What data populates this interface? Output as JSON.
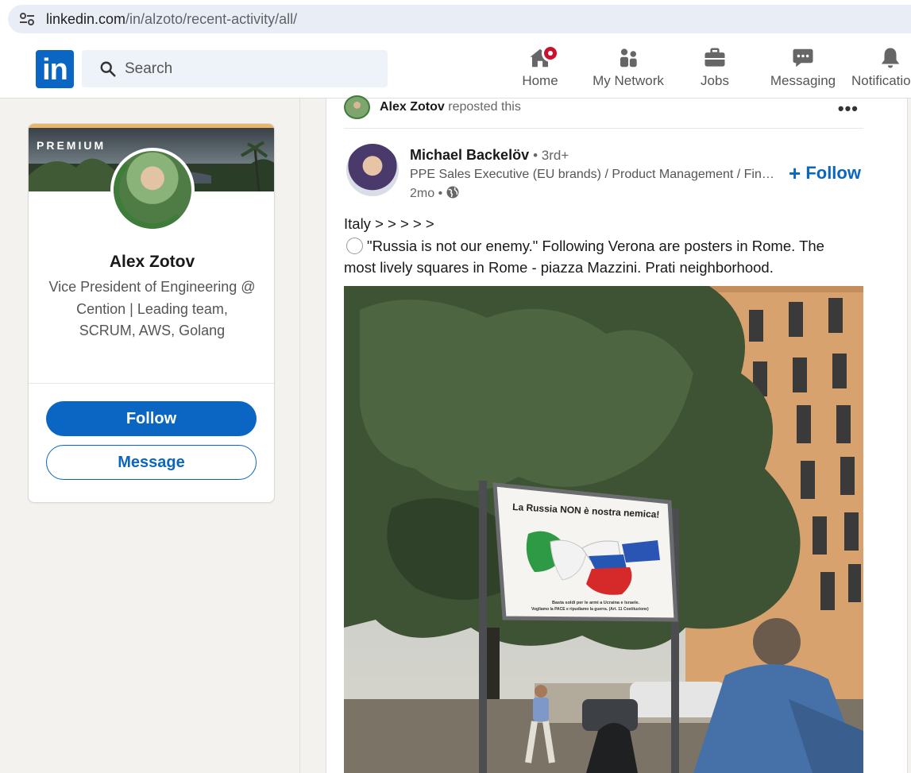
{
  "browser": {
    "url_domain": "linkedin.com",
    "url_path": "/in/alzoto/recent-activity/all/"
  },
  "header": {
    "logo_text": "in",
    "search_placeholder": "Search",
    "nav": {
      "home": "Home",
      "network": "My Network",
      "jobs": "Jobs",
      "messaging": "Messaging",
      "notifications": "Notifications"
    }
  },
  "profile": {
    "banner_label": "PREMIUM",
    "name": "Alex Zotov",
    "headline": "Vice President of Engineering @ Cention | Leading team, SCRUM, AWS, Golang",
    "follow_label": "Follow",
    "message_label": "Message"
  },
  "repost": {
    "name": "Alex Zotov",
    "action": "reposted this",
    "more": "•••"
  },
  "post": {
    "author": "Michael Backelöv",
    "degree": "• 3rd+",
    "description": "PPE Sales Executive (EU brands) / Product Management / Finance & Business Development",
    "time": "2mo •",
    "follow_label": "Follow",
    "text_line1": "Italy > > > > >",
    "text_line2": "\"Russia is not our enemy.\" Following Verona are posters in Rome. The most lively squares in Rome - piazza Mazzini. Prati neighborhood.",
    "poster_headline": "La Russia NON è nostra nemica!",
    "poster_subline1": "Basta soldi per le armi a Ucraina e Israele.",
    "poster_subline2": "Vogliamo la PACE e ripudiamo la guerra. (Art. 11 Costituzione)"
  },
  "colors": {
    "brand": "#0a66c2",
    "badge": "#cb112d",
    "page_bg": "#f4f2ee"
  }
}
